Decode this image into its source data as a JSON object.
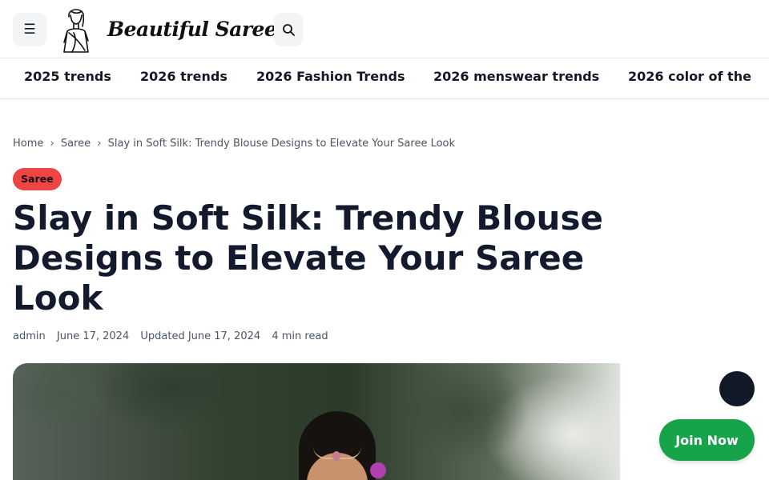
{
  "header": {
    "menu_icon": "hamburger-icon",
    "search_icon": "search-icon",
    "logo_text": "Beautiful Saree"
  },
  "nav": {
    "items": [
      "2025 trends",
      "2026 trends",
      "2026 Fashion Trends",
      "2026 menswear trends",
      "2026 color of the"
    ]
  },
  "breadcrumb": {
    "home": "Home",
    "sep": "›",
    "category": "Saree",
    "current": "Slay in Soft Silk: Trendy Blouse Designs to Elevate Your Saree Look"
  },
  "article": {
    "category_badge": "Saree",
    "title": "Slay in Soft Silk: Trendy Blouse Designs to Elevate Your Saree Look",
    "author": "admin",
    "date": "June 17, 2024",
    "updated": "Updated June 17, 2024",
    "read_time": "4 min read"
  },
  "cta": {
    "join_label": "Join Now"
  },
  "colors": {
    "badge": "#ef4444",
    "join": "#16a34a",
    "fab": "#111827"
  }
}
